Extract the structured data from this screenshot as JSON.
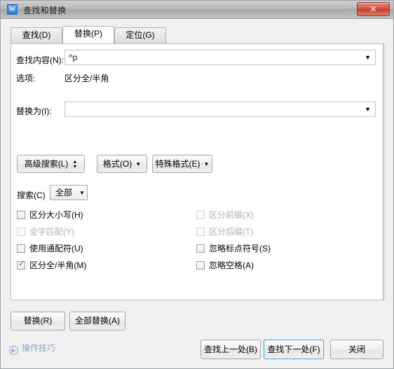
{
  "window": {
    "title": "查找和替换",
    "app_icon": "wps-writer-icon",
    "close_label": "✕"
  },
  "tabs": [
    {
      "label": "查找(D)",
      "active": false
    },
    {
      "label": "替换(P)",
      "active": true
    },
    {
      "label": "定位(G)",
      "active": false
    }
  ],
  "find": {
    "label": "查找内容(N):",
    "value": "^p",
    "placeholder": ""
  },
  "options": {
    "label": "选项:",
    "value": "区分全/半角"
  },
  "replace": {
    "label": "替换为(I):",
    "value": "",
    "placeholder": ""
  },
  "option_buttons": [
    {
      "label": "高级搜索(L)",
      "arrow": "updown"
    },
    {
      "label": "格式(O)",
      "arrow": "down"
    },
    {
      "label": "特殊格式(E)",
      "arrow": "down"
    }
  ],
  "scope": {
    "label": "搜索(C)",
    "value": "全部",
    "arrow": "▼"
  },
  "checkboxes_left": [
    {
      "label": "区分大小写(H)",
      "checked": false,
      "disabled": false
    },
    {
      "label": "全字匹配(Y)",
      "checked": false,
      "disabled": true
    },
    {
      "label": "使用通配符(U)",
      "checked": false,
      "disabled": false
    },
    {
      "label": "区分全/半角(M)",
      "checked": true,
      "disabled": false
    }
  ],
  "checkboxes_right": [
    {
      "label": "区分前缀(X)",
      "checked": false,
      "disabled": true
    },
    {
      "label": "区分后缀(T)",
      "checked": false,
      "disabled": true
    },
    {
      "label": "忽略标点符号(S)",
      "checked": false,
      "disabled": false
    },
    {
      "label": "忽略空格(A)",
      "checked": false,
      "disabled": false
    }
  ],
  "action_buttons": [
    {
      "label": "替换(R)"
    },
    {
      "label": "全部替换(A)"
    }
  ],
  "footer_buttons": [
    {
      "label": "查找上一处(B)",
      "default": false
    },
    {
      "label": "查找下一处(F)",
      "default": true
    },
    {
      "label": "关闭",
      "default": false
    }
  ],
  "tip": {
    "label": "操作技巧",
    "icon": "play-circle-icon"
  },
  "colors": {
    "accent": "#3c9ad9",
    "close_red": "#c23b2e",
    "link_blue": "#8fa8d8"
  }
}
